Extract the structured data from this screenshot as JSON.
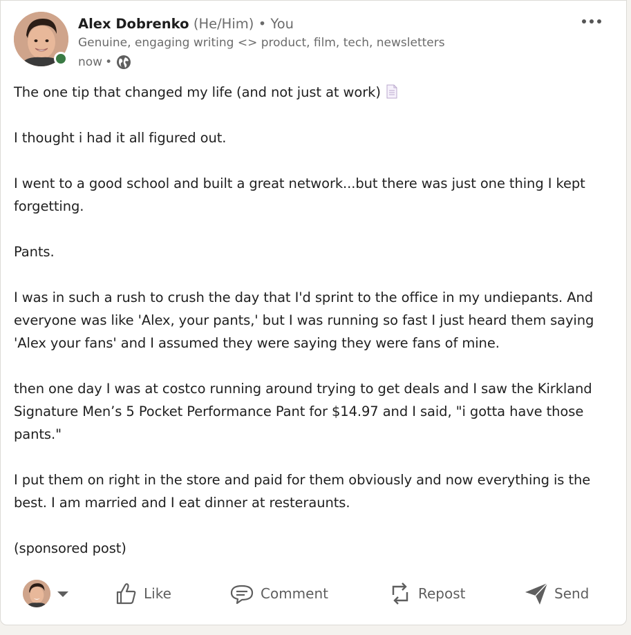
{
  "post": {
    "author": {
      "name": "Alex Dobrenko",
      "pronouns": "(He/Him)",
      "relation": "• You",
      "headline": "Genuine, engaging writing <> product, film, tech, newsletters",
      "time": "now",
      "separator": "•",
      "visibility_icon": "globe-icon",
      "presence_color": "#3a7a44"
    },
    "menu_icon": "more-horizontal-icon",
    "title": "The one tip that changed my life (and not just at work)",
    "title_icon": "document-icon",
    "paragraphs": [
      "I thought i had it all figured out.",
      "I went to a good school and built a great network...but there was just one thing I kept forgetting.",
      "Pants.",
      "I was in such a rush to crush the day that I'd sprint to the office in my undiepants. And everyone was like 'Alex, your pants,' but I was running so fast I just heard them saying 'Alex your fans' and I assumed they were saying they were fans of mine.",
      "then one day I was at costco running around trying to get deals and I saw the Kirkland Signature Men’s 5 Pocket Performance Pant for $14.97 and I said, \"i gotta have those pants.\"",
      "I put them on right in the store and paid for them obviously and now everything is the best. I am married and I eat dinner at resteraunts.",
      "(sponsored post)"
    ]
  },
  "actions": {
    "like": "Like",
    "comment": "Comment",
    "repost": "Repost",
    "send": "Send"
  }
}
